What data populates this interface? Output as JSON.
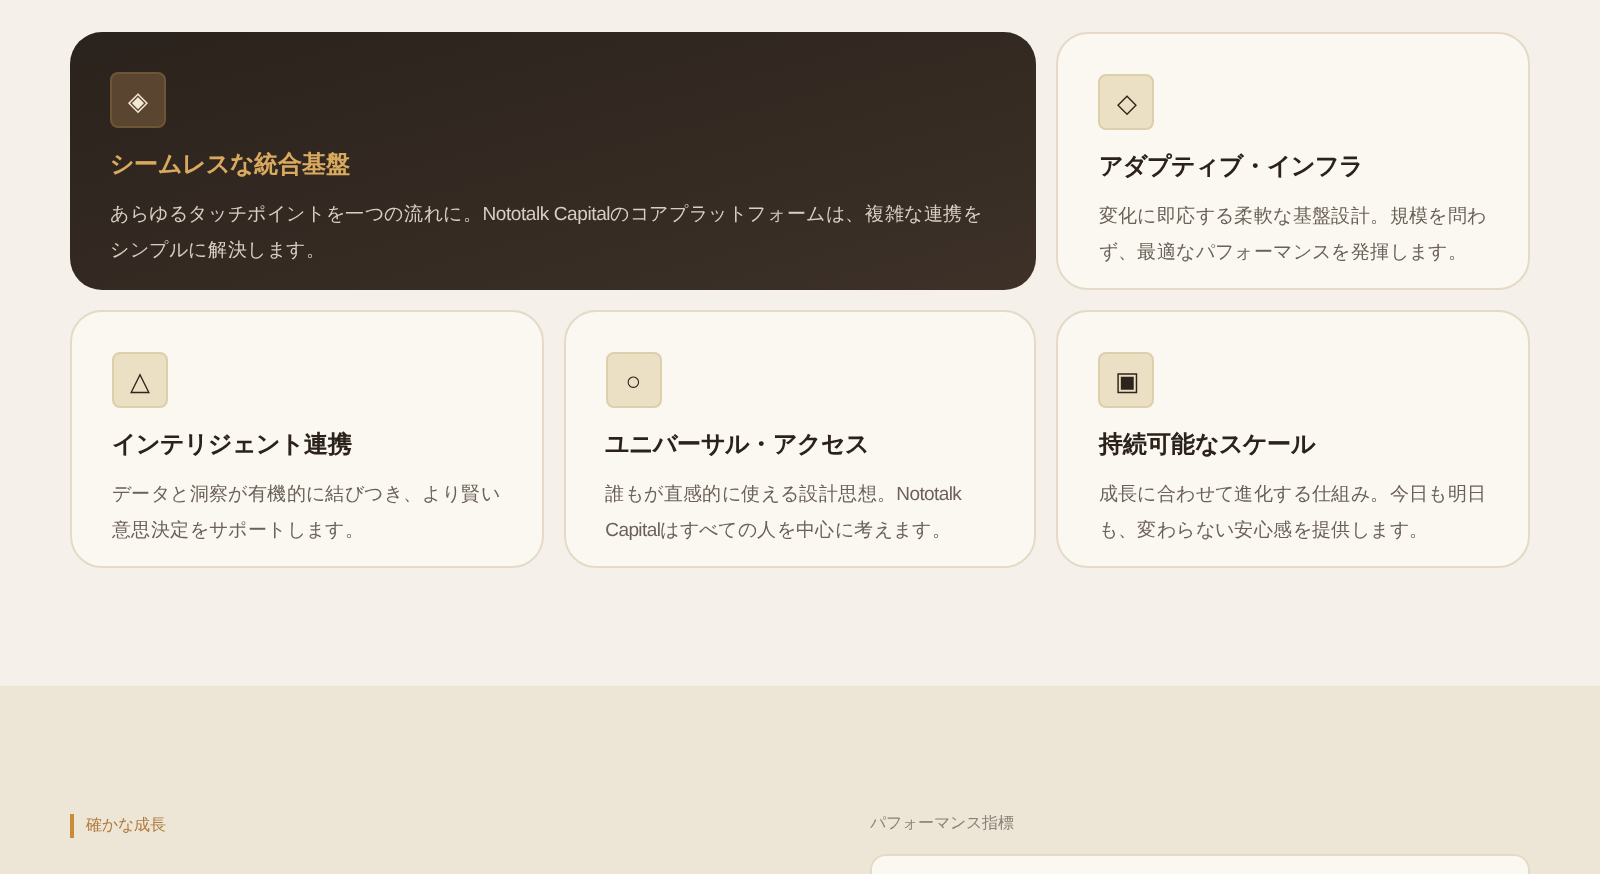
{
  "features": [
    {
      "kind": "dark",
      "icon": "◈",
      "title": "シームレスな統合基盤",
      "text": "あらゆるタッチポイントを一つの流れに。Nototalk Capitalのコアプラットフォームは、複雑な連携をシンプルに解決します。"
    },
    {
      "kind": "light",
      "icon": "◇",
      "title": "アダプティブ・インフラ",
      "text": "変化に即応する柔軟な基盤設計。規模を問わず、最適なパフォーマンスを発揮します。"
    },
    {
      "kind": "light",
      "icon": "△",
      "title": "インテリジェント連携",
      "text": "データと洞察が有機的に結びつき、より賢い意思決定をサポートします。"
    },
    {
      "kind": "light",
      "icon": "○",
      "title": "ユニバーサル・アクセス",
      "text": "誰もが直感的に使える設計思想。Nototalk Capitalはすべての人を中心に考えます。"
    },
    {
      "kind": "light",
      "icon": "▣",
      "title": "持続可能なスケール",
      "text": "成長に合わせて進化する仕組み。今日も明日も、変わらない安心感を提供します。"
    }
  ],
  "growth": {
    "eyebrow": "確かな成長",
    "metrics_label": "パフォーマンス指標"
  }
}
